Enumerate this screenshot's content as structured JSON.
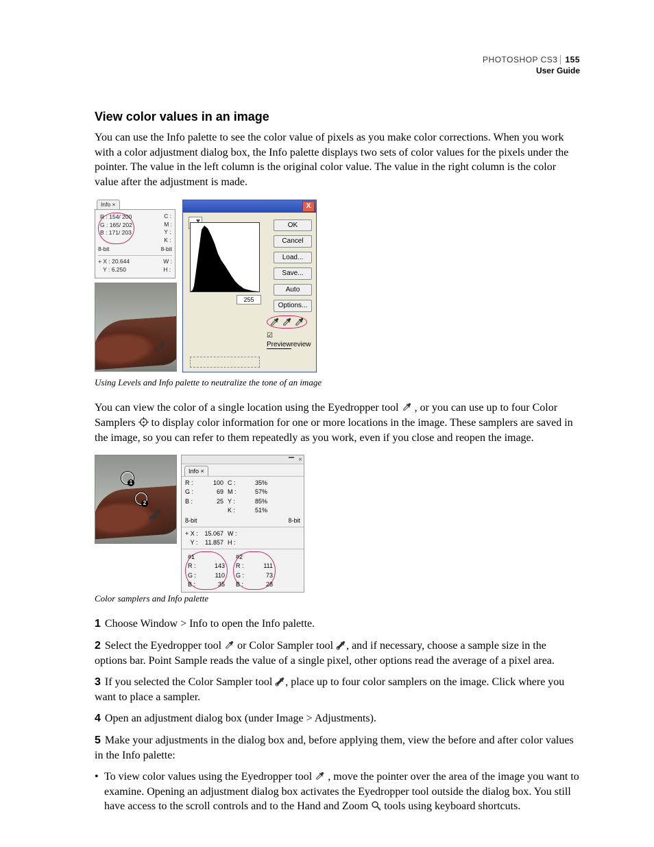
{
  "header": {
    "product": "PHOTOSHOP CS3",
    "guide": "User Guide",
    "page": "155"
  },
  "h2": "View color values in an image",
  "intro": "You can use the Info palette to see the color value of pixels as you make color corrections. When you work with a color adjustment dialog box, the Info palette displays two sets of color values for the pixels under the pointer. The value in the left column is the original color value. The value in the right column is the color value after the adjustment is made.",
  "fig1": {
    "info_tab": "Info ×",
    "rgb": {
      "R": "154/ 200",
      "G": "165/ 202",
      "B": "171/ 203"
    },
    "cmyk_labels": {
      "C": "C :",
      "M": "M :",
      "Y": "Y :",
      "K": "K :"
    },
    "bits": "8-bit",
    "xy": {
      "X": "20.644",
      "Y": "6.250"
    },
    "wh_labels": {
      "W": "W :",
      "H": "H :"
    },
    "buttons": {
      "ok": "OK",
      "cancel": "Cancel",
      "load": "Load...",
      "save": "Save...",
      "auto": "Auto",
      "options": "Options..."
    },
    "input_max": "255",
    "preview": "Preview",
    "close_x": "X",
    "caption": "Using Levels and Info palette to neutralize the tone of an image"
  },
  "mid_para_a": "You can view the color of a single location using the Eyedropper tool ",
  "mid_para_b": ", or you can use up to four Color Samplers ",
  "mid_para_c": " to display color information for one or more locations in the image. These samplers are saved in the image, so you can refer to them repeatedly as you work, even if you close and reopen the image.",
  "fig2": {
    "tab": "Info ×",
    "rgb": {
      "R": "100",
      "G": "69",
      "B": "25"
    },
    "cmyk": {
      "C": "35%",
      "M": "57%",
      "Y": "85%",
      "K": "51%"
    },
    "bits": "8-bit",
    "xy": {
      "X": "15.067",
      "Y": "11.857"
    },
    "s1": {
      "label": "#1",
      "R": "143",
      "G": "110",
      "B": "35"
    },
    "s2": {
      "label": "#2",
      "R": "111",
      "G": "73",
      "B": "28"
    },
    "caption": "Color samplers and Info palette"
  },
  "steps": {
    "s1": {
      "n": "1",
      "t": "Choose Window > Info to open the Info palette."
    },
    "s2": {
      "n": "2",
      "a": "Select the Eyedropper tool ",
      "b": " or Color Sampler tool ",
      "c": ", and if necessary, choose a sample size in the options bar. Point Sample reads the value of a single pixel, other options read the average of a pixel area."
    },
    "s3": {
      "n": "3",
      "a": "If you selected the Color Sampler tool ",
      "b": ", place up to four color samplers on the image. Click where you want to place a sampler."
    },
    "s4": {
      "n": "4",
      "t": "Open an adjustment dialog box (under Image > Adjustments)."
    },
    "s5": {
      "n": "5",
      "t": "Make your adjustments in the dialog box and, before applying them, view the before and after color values in the Info palette:"
    }
  },
  "bullet": {
    "a": "To view color values using the Eyedropper tool ",
    "b": ", move the pointer over the area of the image you want to examine. Opening an adjustment dialog box activates the Eyedropper tool outside the dialog box. You still have access to the scroll controls and to the Hand and Zoom ",
    "c": " tools using keyboard shortcuts."
  }
}
